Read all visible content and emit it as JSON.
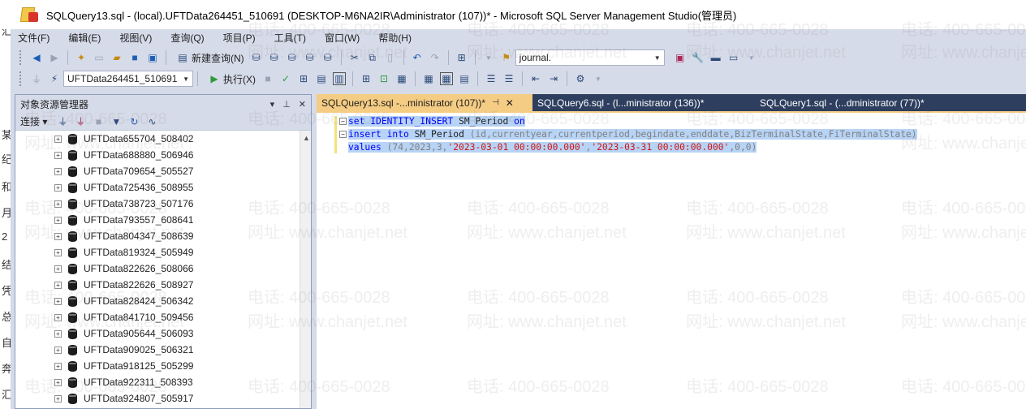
{
  "window": {
    "title": "SQLQuery13.sql - (local).UFTData264451_510691 (DESKTOP-M6NA2IR\\Administrator (107))* - Microsoft SQL Server Management Studio(管理员)"
  },
  "left_edge_chars": [
    "汇",
    "某",
    "纪",
    "和",
    "月",
    "2",
    "结",
    "凭",
    "总",
    "自",
    "奔",
    "汇"
  ],
  "menu": {
    "items": [
      "文件(F)",
      "编辑(E)",
      "视图(V)",
      "查询(Q)",
      "项目(P)",
      "工具(T)",
      "窗口(W)",
      "帮助(H)"
    ]
  },
  "toolbar1": {
    "new_query_label": "新建查询(N)",
    "search_combo_value": "journal."
  },
  "toolbar2": {
    "database_combo_value": "UFTData264451_510691",
    "execute_label": "执行(X)"
  },
  "object_explorer": {
    "title": "对象资源管理器",
    "connect_label": "连接",
    "databases": [
      "UFTData655704_508402",
      "UFTData688880_506946",
      "UFTData709654_505527",
      "UFTData725436_508955",
      "UFTData738723_507176",
      "UFTData793557_608641",
      "UFTData804347_508639",
      "UFTData819324_505949",
      "UFTData822626_508066",
      "UFTData822626_508927",
      "UFTData828424_506342",
      "UFTData841710_509456",
      "UFTData905644_506093",
      "UFTData909025_506321",
      "UFTData918125_505299",
      "UFTData922311_508393",
      "UFTData924807_505917"
    ]
  },
  "tabs": [
    {
      "label": "SQLQuery13.sql -...ministrator (107))*",
      "active": true
    },
    {
      "label": "SQLQuery6.sql - (l...ministrator (136))*",
      "active": false
    },
    {
      "label": "SQLQuery1.sql - (...dministrator (77))*",
      "active": false
    }
  ],
  "editor": {
    "line1": {
      "kw1": "set",
      "kw2": "IDENTITY_INSERT",
      "table": "SM_Period",
      "kw3": "on"
    },
    "line2": {
      "kw1": "insert",
      "kw2": "into",
      "table": "SM_Period",
      "cols": "(id,currentyear,currentperiod,begindate,enddate,BizTerminalState,FiTerminalState)"
    },
    "line3": {
      "kw1": "values",
      "nums": "(74,2023,3,",
      "date1": "'2023-03-01 00:00:00.000'",
      "comma": ",",
      "date2": "'2023-03-31 00:00:00.000'",
      "tail": ",0,0)"
    }
  },
  "watermark": {
    "phone": "电话: 400-665-0028",
    "site": "网址: www.chanjet.net"
  }
}
